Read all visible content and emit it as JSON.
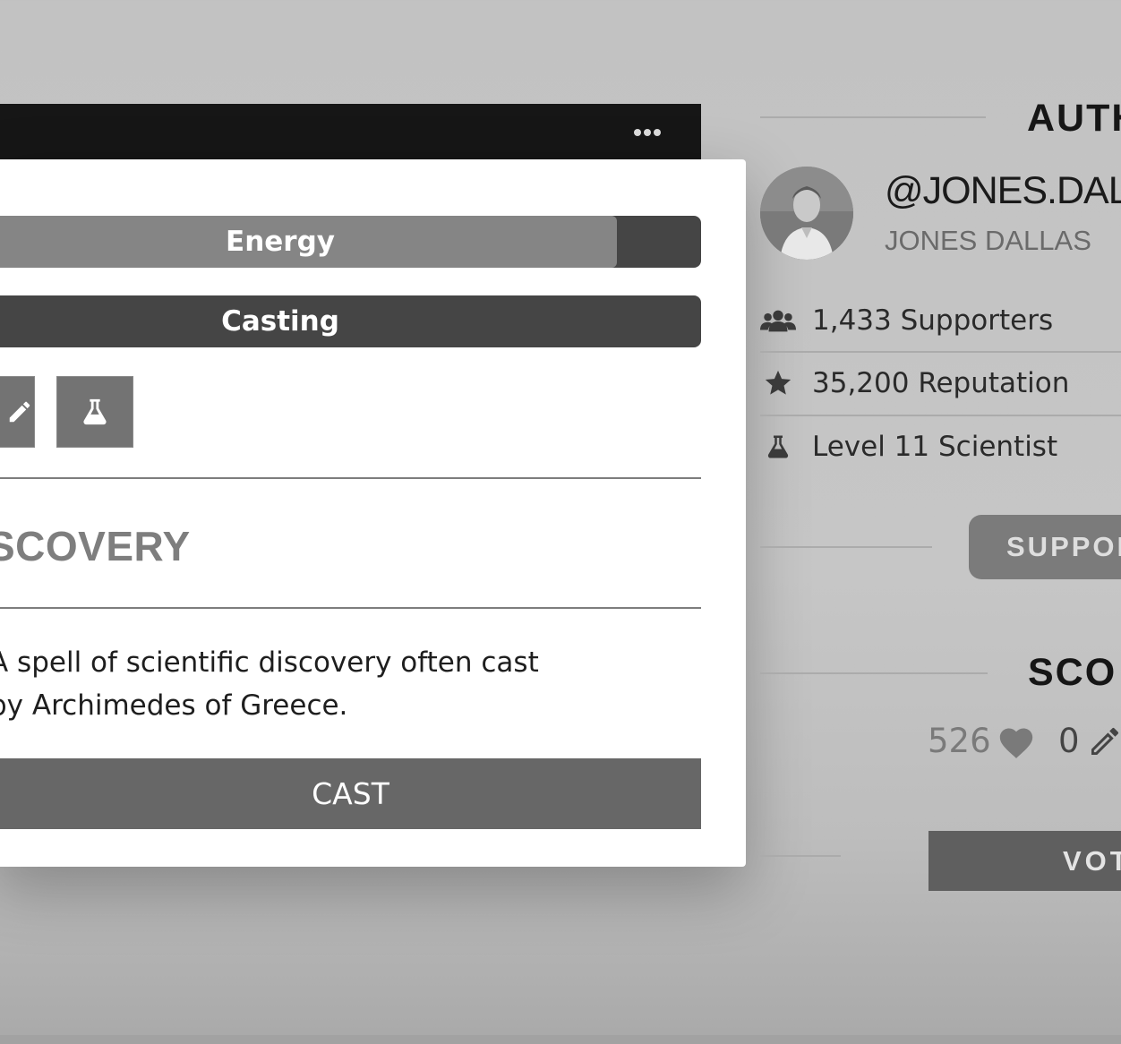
{
  "modal": {
    "energy_label": "Energy",
    "energy_level": 0.88,
    "casting_label": "Casting",
    "title": "SCOVERY",
    "description": "A spell of scientific discovery often cast by Archimedes of Greece.",
    "cast_label": "CAST"
  },
  "author": {
    "section_title": "AUTH",
    "handle": "@JONES.DALL",
    "name": "JONES DALLAS",
    "stats": [
      {
        "icon": "users-icon",
        "text": "1,433 Supporters"
      },
      {
        "icon": "star-icon",
        "text": "35,200 Reputation"
      },
      {
        "icon": "flask-icon",
        "text": "Level 11 Scientist"
      }
    ],
    "support_label": "SUPPOR"
  },
  "score": {
    "section_title": "SCO",
    "likes": "526",
    "edits": "0",
    "vote_label": "VOT"
  }
}
